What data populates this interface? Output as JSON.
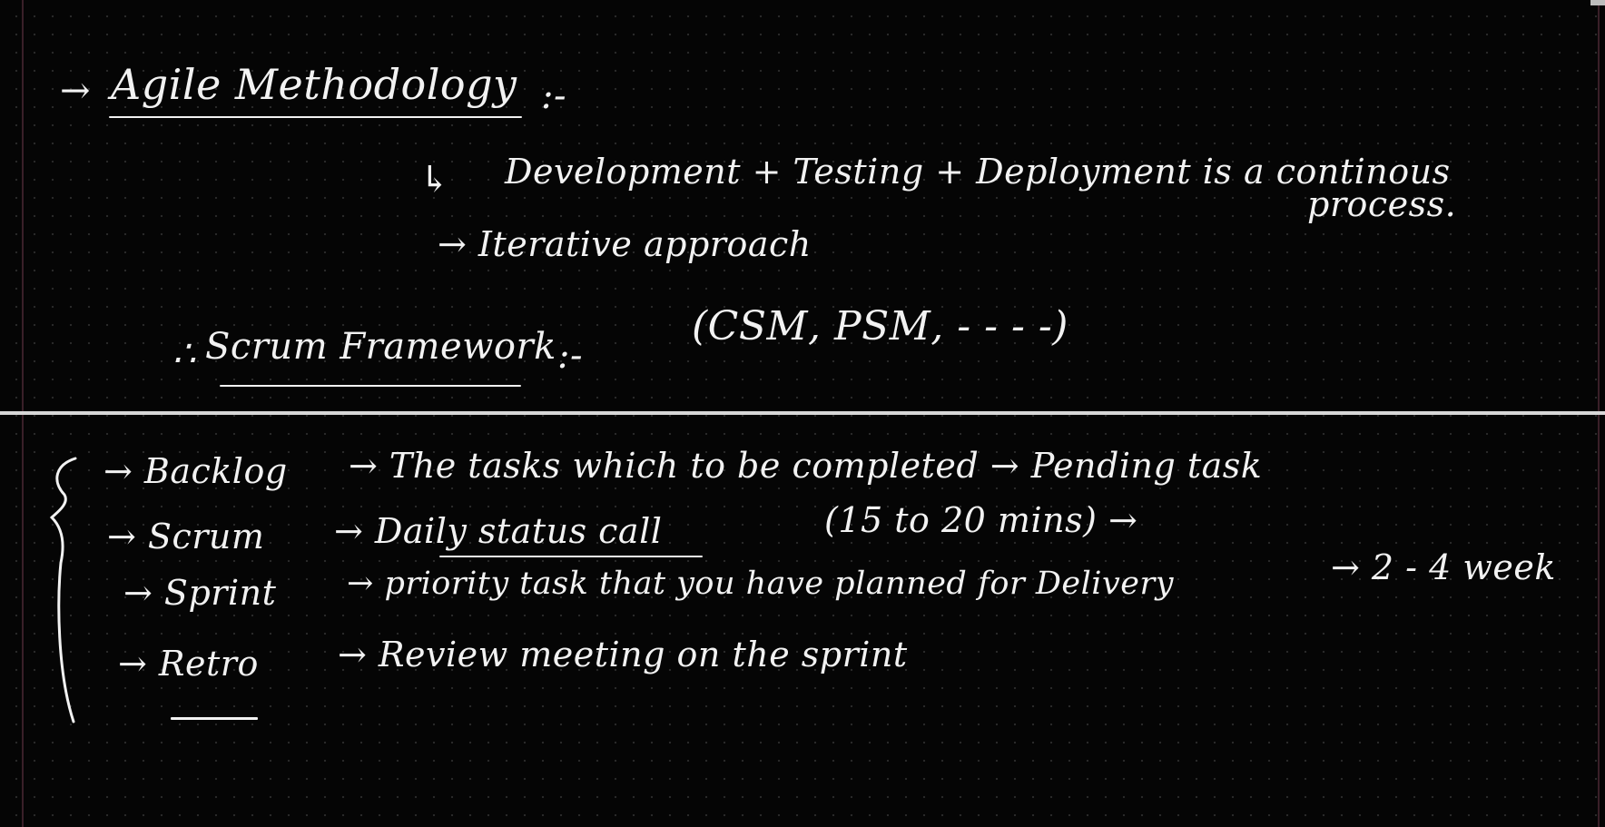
{
  "note": {
    "heading": {
      "arrow": "→",
      "title": "Agile Methodology",
      "suffix": ":-"
    },
    "line1": {
      "lead": "↳",
      "text": "Development + Testing + Deployment is a continous",
      "wrap": "process."
    },
    "line2": "→ Iterative approach",
    "scrum": {
      "lead": "∴",
      "title": "Scrum Framework",
      "suffix": ":-",
      "certs": "(CSM, PSM, - - - -)"
    },
    "items": [
      {
        "label": "→ Backlog",
        "desc": "→ The tasks which to be completed → Pending task"
      },
      {
        "label": "→ Scrum",
        "desc": "→ Daily status call",
        "extra": "(15 to 20 mins) →"
      },
      {
        "label": "→ Sprint",
        "desc": "→ priority task that you have planned for Delivery",
        "extra": "→ 2 - 4 week"
      },
      {
        "label": "→ Retro",
        "desc": "→ Review meeting on the sprint"
      }
    ]
  }
}
